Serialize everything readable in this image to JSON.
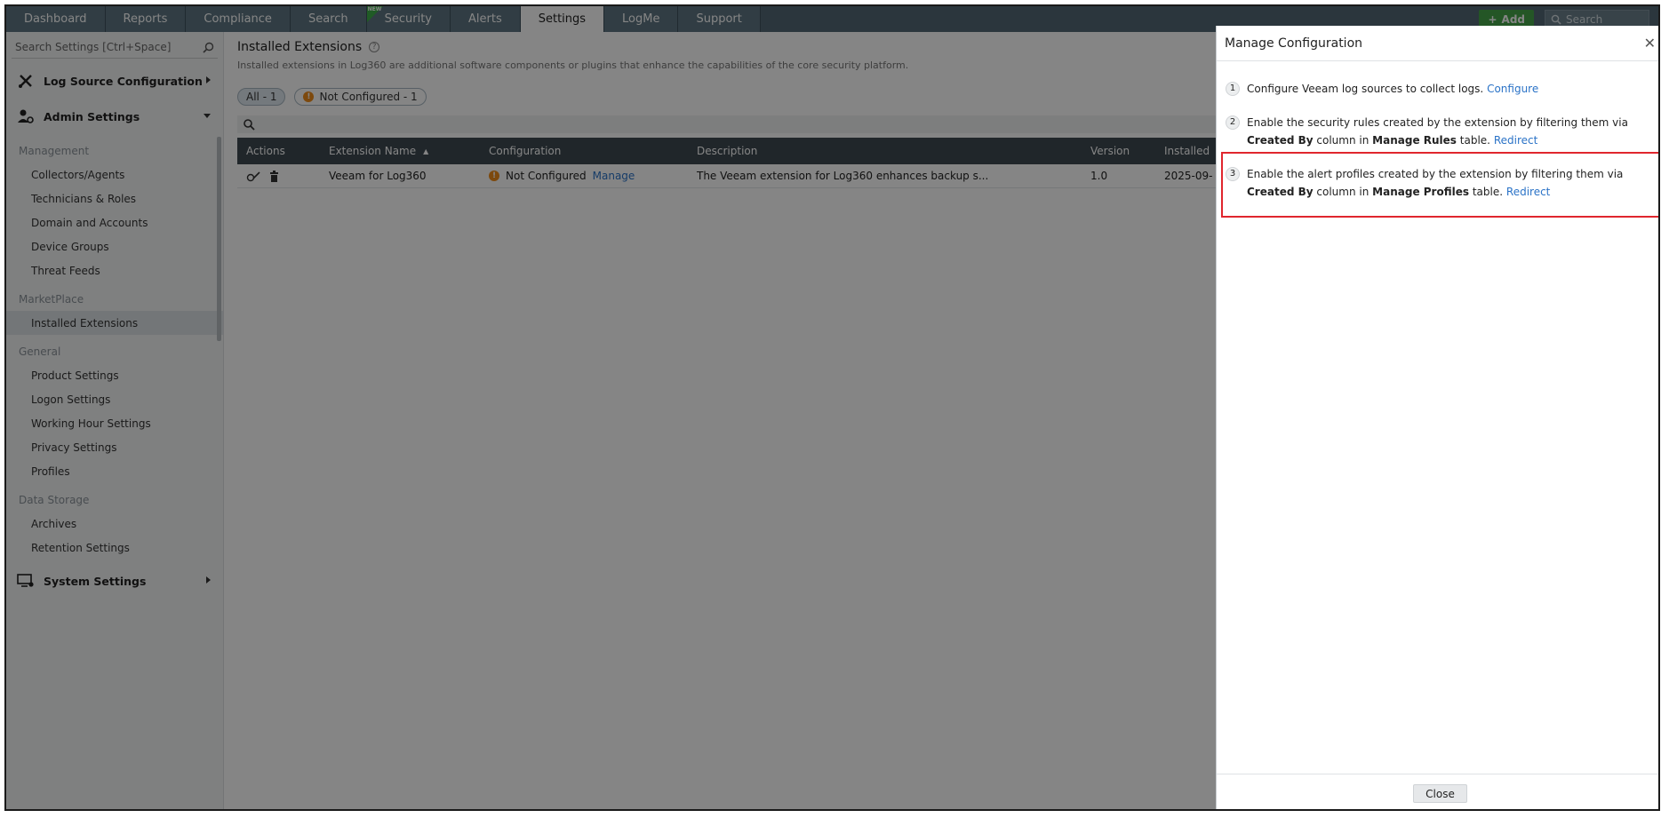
{
  "nav": {
    "tabs": [
      "Dashboard",
      "Reports",
      "Compliance",
      "Search",
      "Security",
      "Alerts",
      "Settings",
      "LogMe",
      "Support"
    ],
    "active": "Settings",
    "new_badge": "NEW",
    "add_label": "Add",
    "search_placeholder": "Search"
  },
  "sidebar": {
    "search_placeholder": "Search Settings [Ctrl+Space]",
    "log_source": "Log Source Configuration",
    "admin": "Admin Settings",
    "sections": {
      "management": "Management",
      "marketplace": "MarketPlace",
      "general": "General",
      "data_storage": "Data Storage"
    },
    "management_items": [
      "Collectors/Agents",
      "Technicians & Roles",
      "Domain and Accounts",
      "Device Groups",
      "Threat Feeds"
    ],
    "marketplace_items": [
      "Installed Extensions"
    ],
    "general_items": [
      "Product Settings",
      "Logon Settings",
      "Working Hour Settings",
      "Privacy Settings",
      "Profiles"
    ],
    "data_items": [
      "Archives",
      "Retention Settings"
    ],
    "system": "System Settings"
  },
  "main": {
    "title": "Installed Extensions",
    "description": "Installed extensions in Log360 are additional software components or plugins that enhance the capabilities of the core security platform.",
    "filter_all": "All - 1",
    "filter_not_configured": "Not Configured - 1",
    "columns": {
      "actions": "Actions",
      "name": "Extension Name",
      "config": "Configuration",
      "desc": "Description",
      "version": "Version",
      "installed": "Installed"
    },
    "row": {
      "name": "Veeam for Log360",
      "config_status": "Not Configured",
      "manage": "Manage",
      "desc": "The Veeam extension for Log360 enhances backup s...",
      "version": "1.0",
      "installed": "2025-09-"
    }
  },
  "panel": {
    "title": "Manage Configuration",
    "step1": {
      "num": "1",
      "text": "Configure Veeam log sources to collect logs.",
      "link": "Configure"
    },
    "step2": {
      "num": "2",
      "t1": "Enable the security rules created by the extension by filtering them via",
      "b1": "Created By",
      "t2": "column in",
      "b2": "Manage Rules",
      "t3": "table.",
      "link": "Redirect"
    },
    "step3": {
      "num": "3",
      "t1": "Enable the alert profiles created by the extension by filtering them via",
      "b1": "Created By",
      "t2": "column in",
      "b2": "Manage Profiles",
      "t3": "table.",
      "link": "Redirect"
    },
    "close": "Close"
  },
  "colors": {
    "nav_bg": "#546975",
    "add_green": "#45a649",
    "link_blue": "#2b73c7",
    "highlight_red": "#e0262e",
    "warn_orange": "#f08c1a"
  }
}
